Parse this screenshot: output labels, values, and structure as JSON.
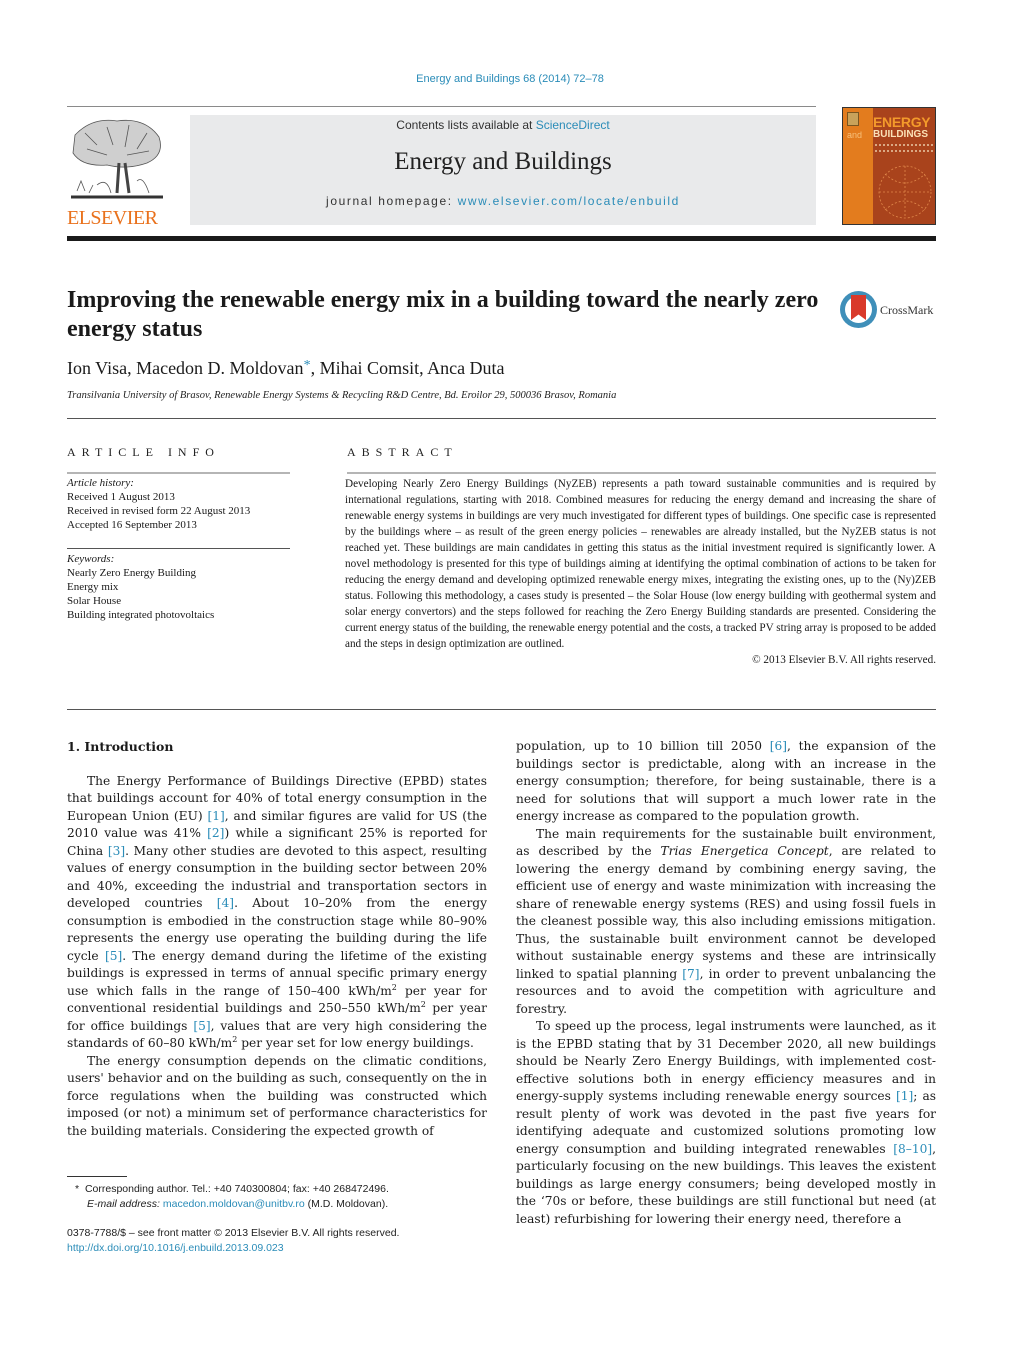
{
  "header": {
    "citation": "Energy and Buildings 68 (2014) 72–78",
    "contents_prefix": "Contents lists available at ",
    "contents_link": "ScienceDirect",
    "journal_name": "Energy and Buildings",
    "homepage_prefix": "journal homepage: ",
    "homepage_link": "www.elsevier.com/locate/enbuild",
    "publisher_logo": "ELSEVIER",
    "cover": {
      "title_line1": "ENERGY",
      "title_and": "and",
      "title_line2": "BUILDINGS",
      "colors": {
        "orange": "#e37c1e",
        "rust": "#a9431c"
      }
    }
  },
  "article": {
    "title": "Improving the renewable energy mix in a building toward the nearly zero energy status",
    "crossmark_label": "CrossMark",
    "authors_before_star": "Ion Visa, Macedon D. Moldovan",
    "corresponding_mark": "*",
    "authors_after_star": ", Mihai Comsit, Anca Duta",
    "affiliation": "Transilvania University of Brasov, Renewable Energy Systems & Recycling R&D Centre, Bd. Eroilor 29, 500036 Brasov, Romania"
  },
  "article_info": {
    "heading": "ARTICLE INFO",
    "history_label": "Article history:",
    "history": [
      "Received 1 August 2013",
      "Received in revised form 22 August 2013",
      "Accepted 16 September 2013"
    ],
    "keywords_label": "Keywords:",
    "keywords": [
      "Nearly Zero Energy Building",
      "Energy mix",
      "Solar House",
      "Building integrated photovoltaics"
    ]
  },
  "abstract": {
    "heading": "ABSTRACT",
    "text": "Developing Nearly Zero Energy Buildings (NyZEB) represents a path toward sustainable communities and is required by international regulations, starting with 2018. Combined measures for reducing the energy demand and increasing the share of renewable energy systems in buildings are very much investigated for different types of buildings. One specific case is represented by the buildings where – as result of the green energy policies – renewables are already installed, but the NyZEB status is not reached yet. These buildings are main candidates in getting this status as the initial investment required is significantly lower. A novel methodology is presented for this type of buildings aiming at identifying the optimal combination of actions to be taken for reducing the energy demand and developing optimized renewable energy mixes, integrating the existing ones, up to the (Ny)ZEB status. Following this methodology, a cases study is presented – the Solar House (low energy building with geothermal system and solar energy convertors) and the steps followed for reaching the Zero Energy Building standards are presented. Considering the current energy status of the building, the renewable energy potential and the costs, a tracked PV string array is proposed to be added and the steps in design optimization are outlined.",
    "copyright": "© 2013 Elsevier B.V. All rights reserved."
  },
  "body": {
    "section_heading": "1.  Introduction",
    "p1": {
      "s1": "The Energy Performance of Buildings Directive (EPBD) states that buildings account for 40% of total energy consumption in the European Union (EU) ",
      "r1": "[1]",
      "s2": ", and similar figures are valid for US (the 2010 value was 41% ",
      "r2": "[2]",
      "s3": ") while a significant 25% is reported for China ",
      "r3": "[3]",
      "s4": ". Many other studies are devoted to this aspect, resulting values of energy consumption in the building sector between 20% and 40%, exceeding the industrial and transportation sectors in developed countries ",
      "r4": "[4]",
      "s5": ". About 10–20% from the energy consumption is embodied in the construction stage while 80–90% represents the energy use operating the building during the life cycle ",
      "r5": "[5]",
      "s6": ". The energy demand during the lifetime of the existing buildings is expressed in terms of annual specific primary energy use which falls in the range of 150–400 kWh/m",
      "sup1": "2",
      "s7": " per year for conventional residential buildings and 250–550 kWh/m",
      "sup2": "2",
      "s8": " per year for office buildings ",
      "r6": "[5]",
      "s9": ", values that are very high considering the standards of 60–80 kWh/m",
      "sup3": "2",
      "s10": " per year set for low energy buildings."
    },
    "p2": "The energy consumption depends on the climatic conditions, users' behavior and on the building as such, consequently on the in force regulations when the building was constructed which imposed (or not) a minimum set of performance characteristics for the building materials. Considering the expected growth of",
    "p3": {
      "s1": "population, up to 10 billion till 2050 ",
      "r1": "[6]",
      "s2": ", the expansion of the buildings sector is predictable, along with an increase in the energy consumption; therefore, for being sustainable, there is a need for solutions that will support a much lower rate in the energy increase as compared to the population growth."
    },
    "p4": {
      "s1": "The main requirements for the sustainable built environment, as described by the ",
      "em": "Trias Energetica Concept",
      "s2": ", are related to lowering the energy demand by combining energy saving, the efficient use of energy and waste minimization with increasing the share of renewable energy systems (RES) and using fossil fuels in the cleanest possible way, this also including emissions mitigation. Thus, the sustainable built environment cannot be developed without sustainable energy systems and these are intrinsically linked to spatial planning ",
      "r1": "[7]",
      "s3": ", in order to prevent unbalancing the resources and to avoid the competition with agriculture and forestry."
    },
    "p5": {
      "s1": "To speed up the process, legal instruments were launched, as it is the EPBD stating that by 31 December 2020, all new buildings should be Nearly Zero Energy Buildings, with implemented cost-effective solutions both in energy efficiency measures and in energy-supply systems including renewable energy sources ",
      "r1": "[1]",
      "s2": "; as result plenty of work was devoted in the past five years for identifying adequate and customized solutions promoting low energy consumption and building integrated renewables ",
      "r2": "[8–10]",
      "s3": ", particularly focusing on the new buildings. This leaves the existent buildings as large energy consumers; being developed mostly in the ‘70s or before, these buildings are still functional but need (at least) refurbishing for lowering their energy need, therefore a"
    }
  },
  "footnote": {
    "mark": "*",
    "corresponding": "Corresponding author. Tel.: +40 740300804; fax: +40 268472496.",
    "email_label": "E-mail address:",
    "email": "macedon.moldovan@unitbv.ro",
    "email_suffix": " (M.D. Moldovan)."
  },
  "issn_line": "0378-7788/$ – see front matter © 2013 Elsevier B.V. All rights reserved.",
  "doi": "http://dx.doi.org/10.1016/j.enbuild.2013.09.023"
}
